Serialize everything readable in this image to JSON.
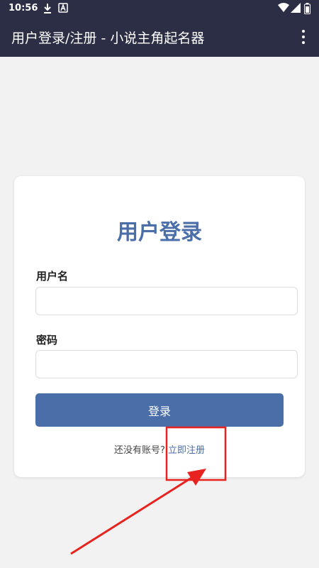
{
  "status_bar": {
    "time": "10:56",
    "icons": [
      "download-icon",
      "app-notification-icon",
      "wifi-icon",
      "signal-icon",
      "battery-icon"
    ]
  },
  "app_bar": {
    "title": "用户登录/注册 - 小说主角起名器",
    "menu_icon": "more-vert-icon"
  },
  "login_card": {
    "title": "用户登录",
    "username_label": "用户名",
    "username_value": "",
    "password_label": "密码",
    "password_value": "",
    "login_button_label": "登录",
    "register_prompt": "还没有账号?",
    "register_link": "立即注册"
  },
  "colors": {
    "app_bar": "#2b2e44",
    "accent": "#4a6ea8",
    "background": "#f2f2f2",
    "annotation": "#e8231f"
  }
}
